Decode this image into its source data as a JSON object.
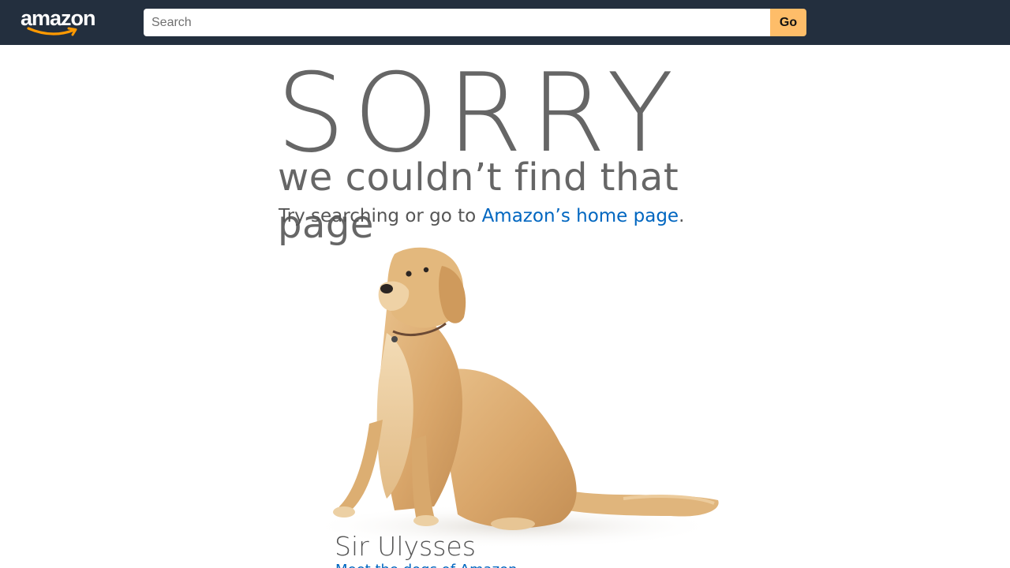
{
  "header": {
    "logo_text": "amazon",
    "search_placeholder": "Search",
    "search_value": "",
    "go_label": "Go"
  },
  "colors": {
    "header_bg": "#232f3e",
    "go_button": "#febd69",
    "link": "#0066c0",
    "heading": "#666666",
    "logo_smile": "#ff9900"
  },
  "error": {
    "heading": "SORRY",
    "subtitle": "we couldn’t find that page",
    "hint_prefix": "Try searching or go to ",
    "home_link": "Amazon’s home page",
    "hint_suffix": "."
  },
  "dog": {
    "name": "Sir Ulysses",
    "link_partial": "Meet the dogs of Amazon"
  },
  "icons": {
    "logo": "amazon-smile-logo",
    "dog": "golden-retriever-photo"
  }
}
